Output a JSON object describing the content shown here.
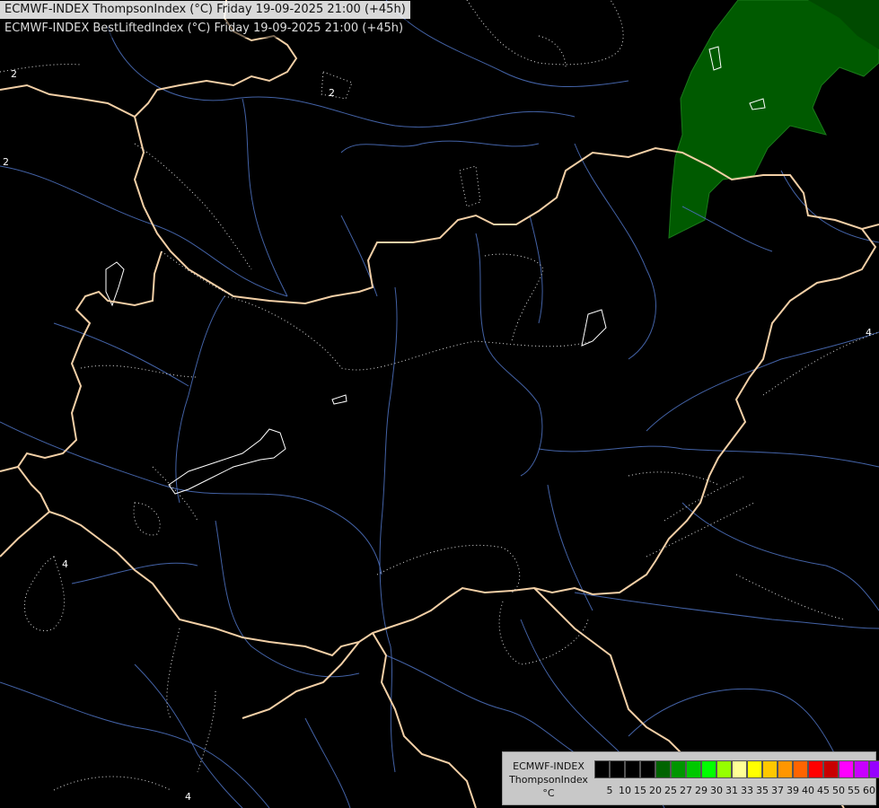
{
  "header": {
    "line1": "ECMWF-INDEX ThompsonIndex (°C) Friday 19-09-2025 21:00 (+45h)",
    "line2": "ECMWF-INDEX BestLiftedIndex (°C) Friday 19-09-2025 21:00 (+45h)"
  },
  "contour_labels": [
    "2",
    "2",
    "2",
    "4",
    "4",
    "4"
  ],
  "legend": {
    "line1": "ECMWF-INDEX",
    "line2": "ThompsonIndex",
    "line3": "°C",
    "colors": [
      "#000000",
      "#000000",
      "#000000",
      "#000000",
      "#006400",
      "#009600",
      "#00c800",
      "#00ff00",
      "#96ff00",
      "#ffff96",
      "#ffff00",
      "#ffc800",
      "#ff9600",
      "#ff6400",
      "#ff0000",
      "#c80000",
      "#ff00ff",
      "#c800ff",
      "#9600ff",
      "#6400ff",
      "#0000ff"
    ],
    "ticks": [
      "5",
      "10",
      "15",
      "20",
      "25",
      "27",
      "29",
      "30",
      "31",
      "33",
      "35",
      "37",
      "39",
      "40",
      "45",
      "50",
      "55",
      "60"
    ]
  }
}
